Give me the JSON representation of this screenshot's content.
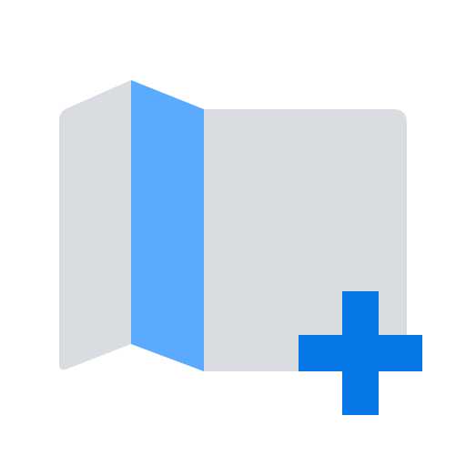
{
  "icon": {
    "name": "add-map-icon",
    "parts": [
      "folded-map",
      "plus-sign"
    ]
  },
  "colors": {
    "map_panel": "#d9dce1",
    "map_fold": "#5aaaff",
    "plus": "#0877e8",
    "background": "#ffffff"
  }
}
